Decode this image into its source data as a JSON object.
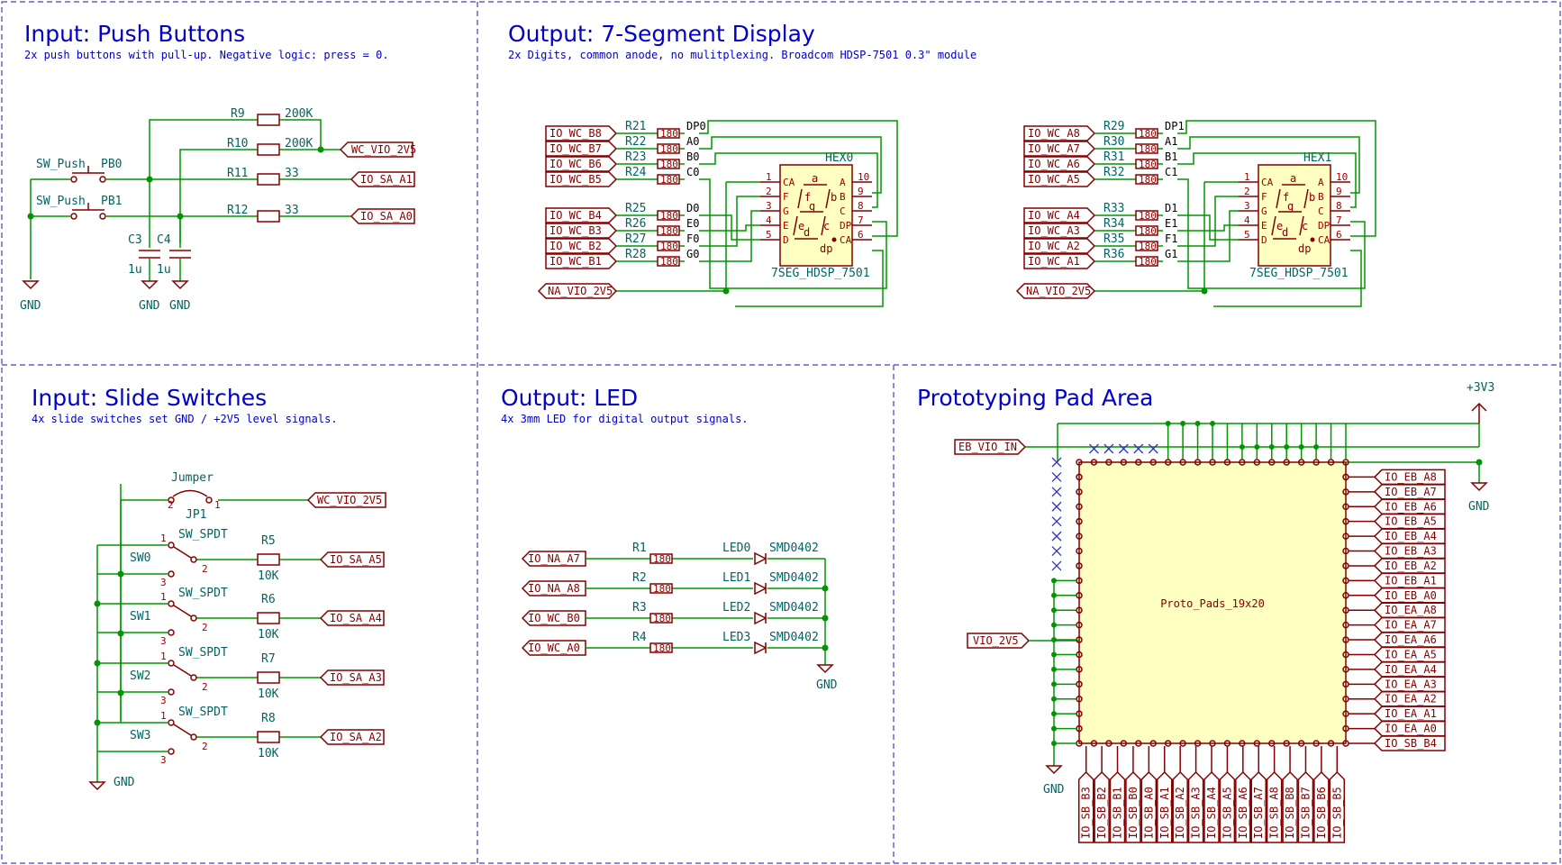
{
  "colors": {
    "wire": "#009600",
    "component": "#840000",
    "title": "#0000c8",
    "ref": "#006464",
    "body": "#ffffc2"
  },
  "sections": {
    "push_buttons": {
      "title": "Input: Push Buttons",
      "subtitle": "2x push buttons with pull-up. Negative logic: press = 0."
    },
    "seven_segment": {
      "title": "Output: 7-Segment Display",
      "subtitle": "2x Digits, common anode, no mulitplexing. Broadcom HDSP-7501 0.3\" module"
    },
    "slide_switches": {
      "title": "Input: Slide Switches",
      "subtitle": "4x slide switches set GND / +2V5 level signals."
    },
    "led": {
      "title": "Output: LED",
      "subtitle": "4x 3mm LED for digital output signals."
    },
    "proto": {
      "title": "Prototyping Pad Area"
    }
  },
  "push_buttons": {
    "resistors": [
      {
        "ref": "R9",
        "value": "200K"
      },
      {
        "ref": "R10",
        "value": "200K"
      },
      {
        "ref": "R11",
        "value": "33"
      },
      {
        "ref": "R12",
        "value": "33"
      }
    ],
    "buttons": [
      {
        "type": "SW_Push",
        "ref": "PB0"
      },
      {
        "type": "SW_Push",
        "ref": "PB1"
      }
    ],
    "caps": [
      {
        "ref": "C3",
        "value": "1u"
      },
      {
        "ref": "C4",
        "value": "1u"
      }
    ],
    "labels": {
      "vio": "WC_VIO_2V5",
      "a1": "IO_SA_A1",
      "a0": "IO_SA_A0"
    },
    "gnd": "GND"
  },
  "seg_left": {
    "labels": [
      "IO_WC_B8",
      "IO_WC_B7",
      "IO_WC_B6",
      "IO_WC_B5",
      "IO_WC_B4",
      "IO_WC_B3",
      "IO_WC_B2",
      "IO_WC_B1"
    ],
    "refs": [
      "R21",
      "R22",
      "R23",
      "R24",
      "R25",
      "R26",
      "R27",
      "R28"
    ],
    "nets": [
      "DP0",
      "A0",
      "B0",
      "C0",
      "D0",
      "E0",
      "F0",
      "G0"
    ],
    "value": "180",
    "chip_ref": "HEX0",
    "chip_part": "7SEG_HDSP_7501",
    "vio": "NA_VIO_2V5"
  },
  "seg_right": {
    "labels": [
      "IO_WC_A8",
      "IO_WC_A7",
      "IO_WC_A6",
      "IO_WC_A5",
      "IO_WC_A4",
      "IO_WC_A3",
      "IO_WC_A2",
      "IO_WC_A1"
    ],
    "refs": [
      "R29",
      "R30",
      "R31",
      "R32",
      "R33",
      "R34",
      "R35",
      "R36"
    ],
    "nets": [
      "DP1",
      "A1",
      "B1",
      "C1",
      "D1",
      "E1",
      "F1",
      "G1"
    ],
    "value": "180",
    "chip_ref": "HEX1",
    "chip_part": "7SEG_HDSP_7501",
    "vio": "NA_VIO_2V5"
  },
  "seg_chip": {
    "left_pins": [
      "CA",
      "F",
      "G",
      "E",
      "D"
    ],
    "left_nums": [
      "1",
      "2",
      "3",
      "4",
      "5"
    ],
    "right_pins": [
      "A",
      "B",
      "C",
      "DP",
      "CA"
    ],
    "right_nums": [
      "10",
      "9",
      "8",
      "7",
      "6"
    ],
    "segs": [
      "a",
      "f",
      "b",
      "g",
      "e",
      "c",
      "d",
      "dp"
    ]
  },
  "slide": {
    "jumper": {
      "type": "Jumper",
      "ref": "JP1",
      "pin_left": "2",
      "pin_right": "1",
      "label": "WC_VIO_2V5"
    },
    "switches": [
      {
        "ref": "SW0",
        "type": "SW_SPDT",
        "res": "R5",
        "value": "10K",
        "label": "IO_SA_A5"
      },
      {
        "ref": "SW1",
        "type": "SW_SPDT",
        "res": "R6",
        "value": "10K",
        "label": "IO_SA_A4"
      },
      {
        "ref": "SW2",
        "type": "SW_SPDT",
        "res": "R7",
        "value": "10K",
        "label": "IO_SA_A3"
      },
      {
        "ref": "SW3",
        "type": "SW_SPDT",
        "res": "R8",
        "value": "10K",
        "label": "IO_SA_A2"
      }
    ],
    "pins": [
      "1",
      "2",
      "3"
    ],
    "gnd": "GND"
  },
  "led": {
    "rows": [
      {
        "label": "IO_NA_A7",
        "ref": "R1",
        "value": "180",
        "led": "LED0",
        "pkg": "SMD0402"
      },
      {
        "label": "IO_NA_A8",
        "ref": "R2",
        "value": "180",
        "led": "LED1",
        "pkg": "SMD0402"
      },
      {
        "label": "IO_WC_B0",
        "ref": "R3",
        "value": "180",
        "led": "LED2",
        "pkg": "SMD0402"
      },
      {
        "label": "IO_WC_A0",
        "ref": "R4",
        "value": "180",
        "led": "LED3",
        "pkg": "SMD0402"
      }
    ],
    "gnd": "GND"
  },
  "proto": {
    "vin": "EB_VIO_IN",
    "vio": "VIO_2V5",
    "plus": "+3V3",
    "gnd_right": "GND",
    "gnd_left": "GND",
    "part": "Proto_Pads_19x20",
    "right_labels": [
      "IO_EB_A8",
      "IO_EB_A7",
      "IO_EB_A6",
      "IO_EB_A5",
      "IO_EB_A4",
      "IO_EB_A3",
      "IO_EB_A2",
      "IO_EB_A1",
      "IO_EB_A0",
      "IO_EA_A8",
      "IO_EA_A7",
      "IO_EA_A6",
      "IO_EA_A5",
      "IO_EA_A4",
      "IO_EA_A3",
      "IO_EA_A2",
      "IO_EA_A1",
      "IO_EA_A0",
      "IO_SB_B4"
    ],
    "bottom_labels": [
      "IO_SB_B3",
      "IO_SB_B2",
      "IO_SB_B1",
      "IO_SB_B0",
      "IO_SB_A0",
      "IO_SB_A1",
      "IO_SB_A2",
      "IO_SB_A3",
      "IO_SB_A4",
      "IO_SB_A5",
      "IO_SB_A6",
      "IO_SB_A7",
      "IO_SB_A8",
      "IO_SB_B8",
      "IO_SB_B7",
      "IO_SB_B6",
      "IO_SB_B5"
    ]
  }
}
